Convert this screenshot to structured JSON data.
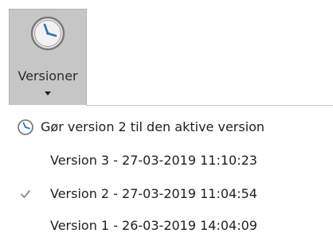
{
  "ribbon": {
    "button_label": "Versioner",
    "icon": "clock-icon",
    "arrow_icon": "dropdown-arrow-icon"
  },
  "menu": {
    "items": [
      {
        "label": "Gør version 2 til den aktive version",
        "icon": "clock-icon"
      },
      {
        "label": "Version 3 - 27-03-2019 11:10:23",
        "icon": ""
      },
      {
        "label": "Version 2 - 27-03-2019 11:04:54",
        "icon": "checkmark-icon"
      },
      {
        "label": "Version 1 - 26-03-2019 14:04:09",
        "icon": ""
      }
    ]
  },
  "colors": {
    "button_pressed_bg": "#c6c6c6",
    "clock_accent": "#2f6fb6",
    "text": "#1f1f1f",
    "checkmark": "#8a8a8a"
  }
}
